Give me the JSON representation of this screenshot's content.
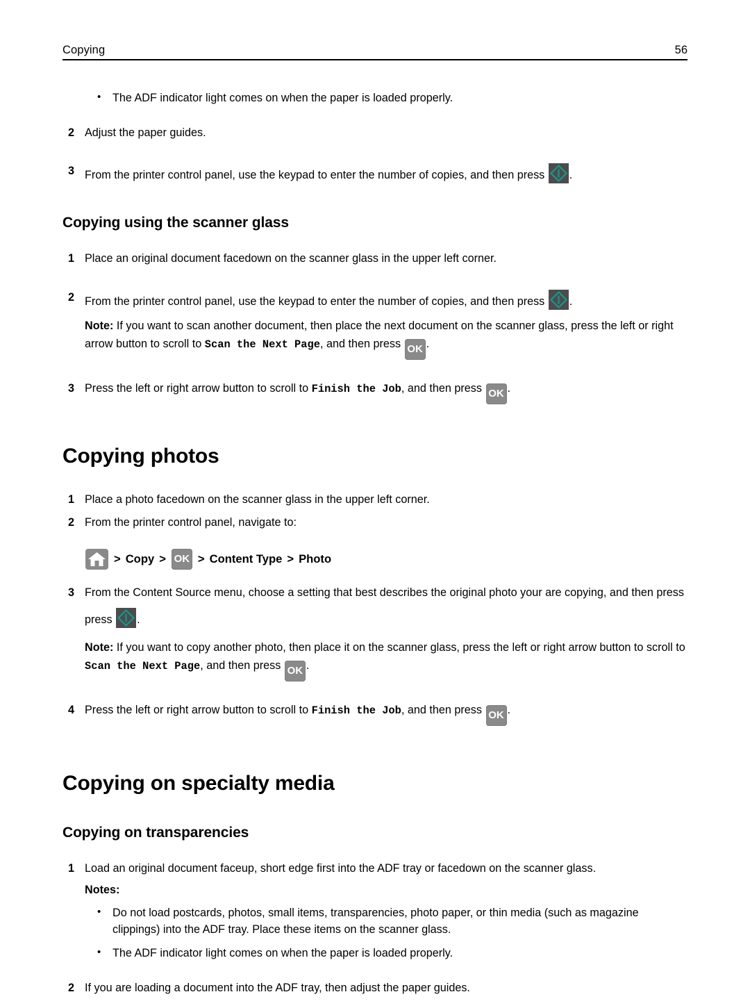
{
  "header": {
    "title": "Copying",
    "page_number": "56"
  },
  "colors": {
    "start_key_bg": "#4c4c4c",
    "start_key_diamond": "#17978b",
    "key_bg": "#8a8a8a",
    "key_fg": "#ffffff",
    "text": "#000000"
  },
  "icons": {
    "ok_label": "OK",
    "home_name": "home-icon",
    "start_name": "start-button-icon"
  },
  "body": {
    "adf_bullet_top": "The ADF indicator light comes on when the paper is loaded properly.",
    "step2_adjust": {
      "num": "2",
      "text": "Adjust the paper guides."
    },
    "step3_keypad": {
      "num": "3",
      "text_before": "From the printer control panel, use the keypad to enter the number of copies, and then press",
      "text_after": "."
    },
    "scanner_glass_heading": "Copying using the scanner glass",
    "sg_step1": {
      "num": "1",
      "text": "Place an original document facedown on the scanner glass in the upper left corner."
    },
    "sg_step2": {
      "num": "2",
      "text_before": "From the printer control panel, use the keypad to enter the number of copies, and then press",
      "text_after": "."
    },
    "sg_note": {
      "label": "Note:",
      "part1": "If you want to scan another document, then place the next document on the scanner glass, press the left or right arrow button to scroll to",
      "mono": "Scan the Next Page",
      "part2": ", and then press",
      "part3": "."
    },
    "sg_step3": {
      "num": "3",
      "part1": "Press the left or right arrow button to scroll to",
      "mono": "Finish the Job",
      "part2": ", and then press",
      "part3": "."
    },
    "photos_heading": "Copying photos",
    "ph_step1": {
      "num": "1",
      "text": "Place a photo facedown on the scanner glass in the upper left corner."
    },
    "ph_step2": {
      "num": "2",
      "text": "From the printer control panel, navigate to:"
    },
    "ph_breadcrumb": {
      "sep": ">",
      "copy": "Copy",
      "content_type": "Content Type",
      "photo": "Photo"
    },
    "ph_step3": {
      "num": "3",
      "text_before": "From the Content Source menu, choose a setting that best describes the original photo your are copying, and then press",
      "press_word": "press",
      "text_after": "."
    },
    "ph_note": {
      "label": "Note:",
      "part1": "If you want to copy another photo, then place it on the scanner glass, press the left or right arrow button to scroll to",
      "mono": "Scan the Next Page",
      "part2": ", and then press",
      "part3": "."
    },
    "ph_step4": {
      "num": "4",
      "part1": "Press the left or right arrow button to scroll to",
      "mono": "Finish the Job",
      "part2": ", and then press",
      "part3": "."
    },
    "specialty_heading": "Copying on specialty media",
    "transparencies_heading": "Copying on transparencies",
    "tr_step1": {
      "num": "1",
      "text": "Load an original document faceup, short edge first into the ADF tray or facedown on the scanner glass."
    },
    "tr_notes_label": "Notes:",
    "tr_bullet1": "Do not load postcards, photos, small items, transparencies, photo paper, or thin media (such as magazine clippings) into the ADF tray. Place these items on the scanner glass.",
    "tr_bullet2": "The ADF indicator light comes on when the paper is loaded properly.",
    "tr_step2": {
      "num": "2",
      "text": "If you are loading a document into the ADF tray, then adjust the paper guides."
    }
  }
}
